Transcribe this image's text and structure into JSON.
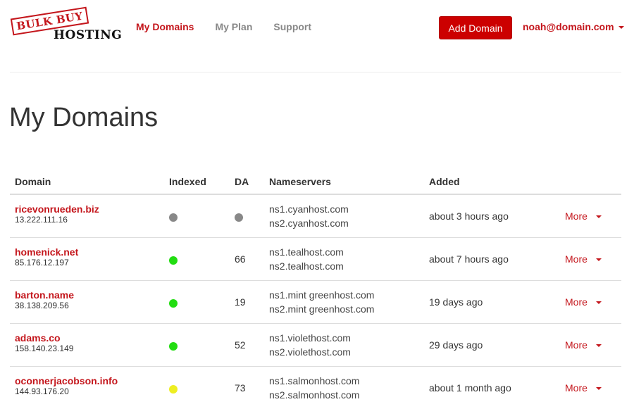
{
  "brand": {
    "stamp": "BULK BUY",
    "subtitle": "HOSTING",
    "accent": "#c4161c"
  },
  "nav": [
    {
      "label": "My Domains",
      "active": true
    },
    {
      "label": "My Plan",
      "active": false
    },
    {
      "label": "Support",
      "active": false
    }
  ],
  "header": {
    "add_button": "Add Domain",
    "user_email": "noah@domain.com"
  },
  "page_title": "My Domains",
  "table": {
    "columns": [
      "Domain",
      "Indexed",
      "DA",
      "Nameservers",
      "Added",
      ""
    ],
    "rows": [
      {
        "domain": "ricevonrueden.biz",
        "ip": "13.222.111.16",
        "indexed": "unknown",
        "indexed_color": "#888888",
        "da": "",
        "da_color": "#888888",
        "ns1": "ns1.cyanhost.com",
        "ns2": "ns2.cyanhost.com",
        "added": "about 3 hours ago",
        "action": "More"
      },
      {
        "domain": "homenick.net",
        "ip": "85.176.12.197",
        "indexed": "yes",
        "indexed_color": "#22dd11",
        "da": "66",
        "ns1": "ns1.tealhost.com",
        "ns2": "ns2.tealhost.com",
        "added": "about 7 hours ago",
        "action": "More"
      },
      {
        "domain": "barton.name",
        "ip": "38.138.209.56",
        "indexed": "yes",
        "indexed_color": "#22dd11",
        "da": "19",
        "ns1": "ns1.mint greenhost.com",
        "ns2": "ns2.mint greenhost.com",
        "added": "19 days ago",
        "action": "More"
      },
      {
        "domain": "adams.co",
        "ip": "158.140.23.149",
        "indexed": "yes",
        "indexed_color": "#22dd11",
        "da": "52",
        "ns1": "ns1.violethost.com",
        "ns2": "ns2.violethost.com",
        "added": "29 days ago",
        "action": "More"
      },
      {
        "domain": "oconnerjacobson.info",
        "ip": "144.93.176.20",
        "indexed": "partial",
        "indexed_color": "#eeee22",
        "da": "73",
        "ns1": "ns1.salmonhost.com",
        "ns2": "ns2.salmonhost.com",
        "added": "about 1 month ago",
        "action": "More"
      }
    ]
  }
}
